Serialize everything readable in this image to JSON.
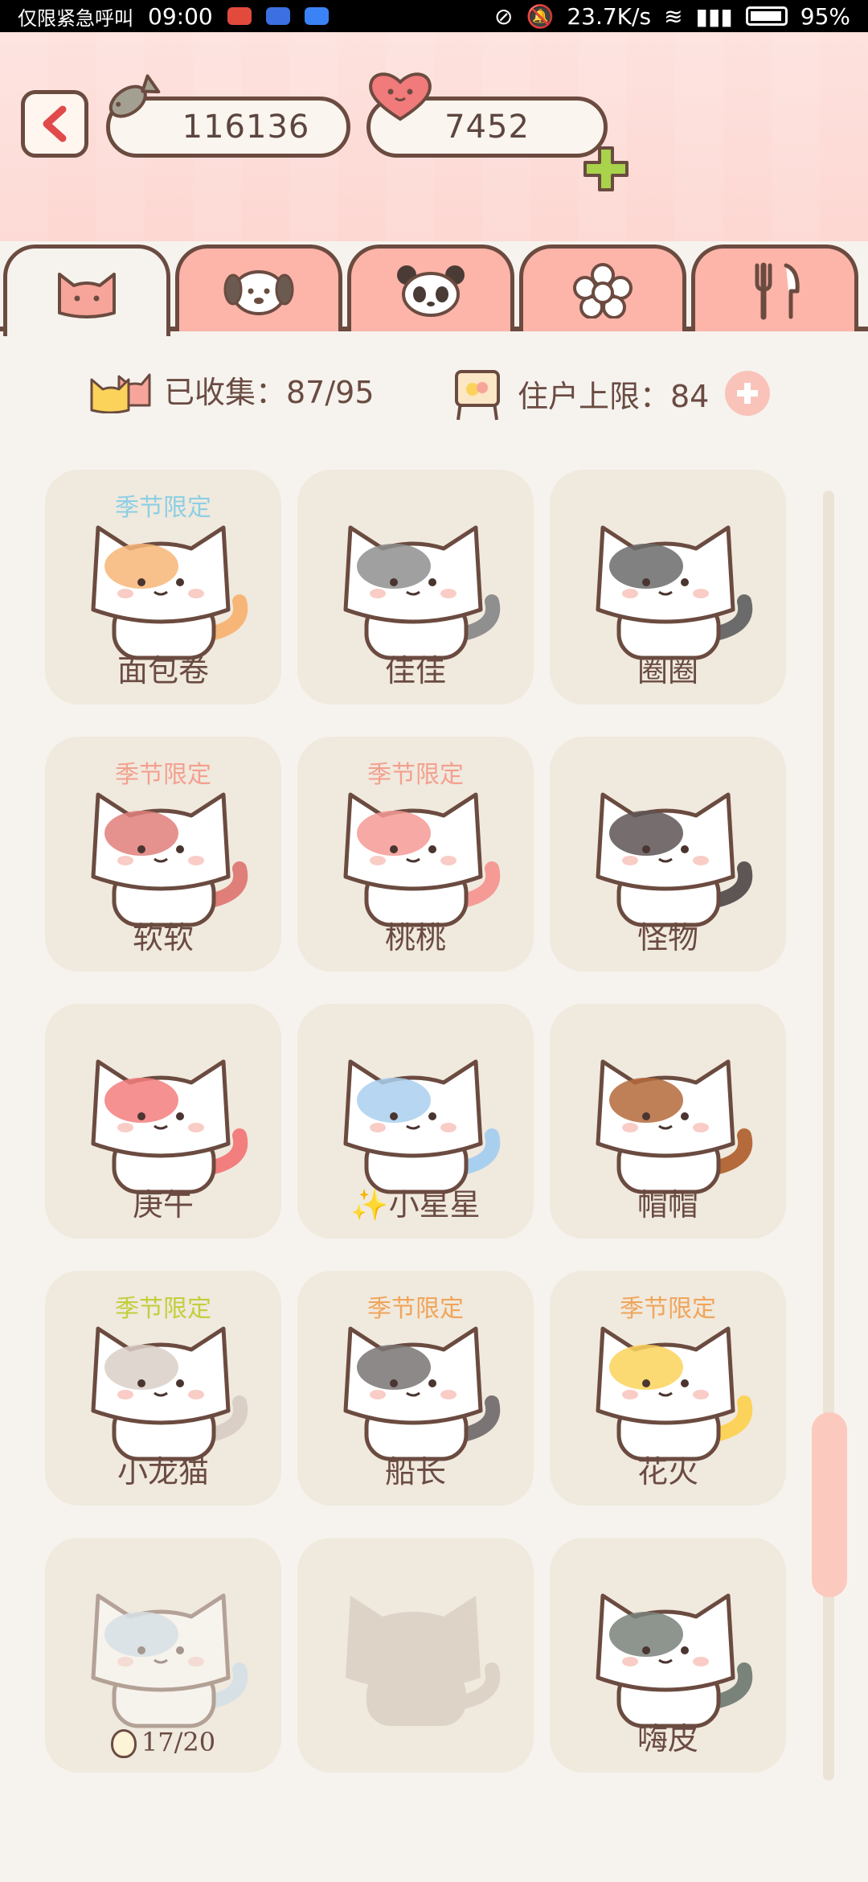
{
  "status_bar": {
    "carrier": "仅限紧急呼叫",
    "time": "09:00",
    "net_speed": "23.7K/s",
    "battery": "95%",
    "app_icon_colors": [
      "#e24a3b",
      "#3b6fe2",
      "#3b82f6"
    ]
  },
  "header": {
    "fish_count": "116136",
    "heart_count": "7452",
    "icons": [
      "back-arrow-icon",
      "fish-icon",
      "heart-icon",
      "plus-icon"
    ]
  },
  "tabs": [
    {
      "name": "cat",
      "active": true
    },
    {
      "name": "dog",
      "active": false
    },
    {
      "name": "panda",
      "active": false
    },
    {
      "name": "flower",
      "active": false
    },
    {
      "name": "utensils",
      "active": false
    }
  ],
  "stats": {
    "collected_label": "已收集：87/95",
    "residents_label": "住户上限：84"
  },
  "cats": [
    {
      "name": "面包卷",
      "season": "季节限定",
      "season_color": "#8dcfe3",
      "color": "#f7b677"
    },
    {
      "name": "佳佳",
      "season": "",
      "season_color": "",
      "color": "#8f8f8f"
    },
    {
      "name": "圈圈",
      "season": "",
      "season_color": "",
      "color": "#6b6b6b"
    },
    {
      "name": "软软",
      "season": "季节限定",
      "season_color": "#f3a08f",
      "color": "#e07f7a"
    },
    {
      "name": "桃桃",
      "season": "季节限定",
      "season_color": "#f3a08f",
      "color": "#f59a95"
    },
    {
      "name": "怪物",
      "season": "",
      "season_color": "",
      "color": "#5e5555"
    },
    {
      "name": "庚午",
      "season": "",
      "season_color": "",
      "color": "#f37e7e"
    },
    {
      "name": "小星星",
      "season": "",
      "season_color": "",
      "color": "#a9cfee",
      "prefix": "✨"
    },
    {
      "name": "帽帽",
      "season": "",
      "season_color": "",
      "color": "#b46a3b"
    },
    {
      "name": "小龙猫",
      "season": "季节限定",
      "season_color": "#c2cf3b",
      "color": "#d9cfc7"
    },
    {
      "name": "船长",
      "season": "季节限定",
      "season_color": "#f0a55a",
      "color": "#7a7474"
    },
    {
      "name": "花火",
      "season": "季节限定",
      "season_color": "#f0a55a",
      "color": "#fcd35a"
    },
    {
      "name": "",
      "season": "",
      "season_color": "",
      "color": "#b8d6ee",
      "progress": "17/20",
      "faded": true
    },
    {
      "name": "",
      "season": "",
      "season_color": "",
      "color": "#ddd3c6",
      "silhouette": true
    },
    {
      "name": "嗨皮",
      "season": "",
      "season_color": "",
      "color": "#7a837a"
    }
  ],
  "colors": {
    "outline": "#6b4b40",
    "header_bg": "#fdd7d2",
    "tab_bg": "#fdb4a9",
    "card_bg": "#f0e9de",
    "accent_green": "#a8d34a"
  }
}
